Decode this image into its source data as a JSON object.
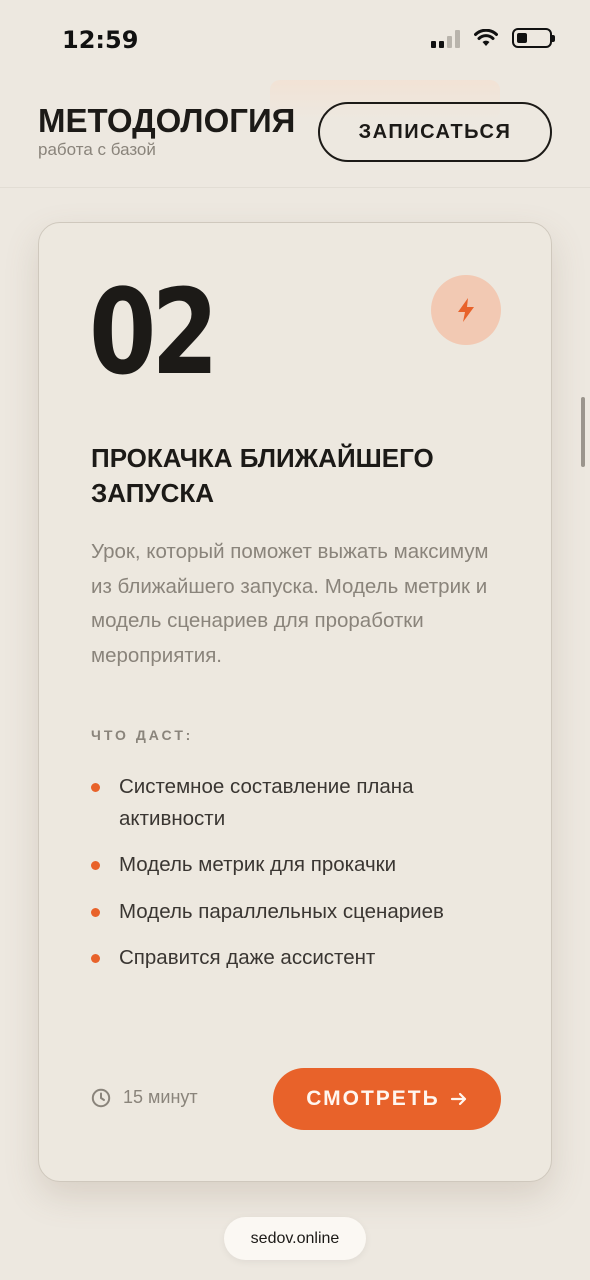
{
  "status_bar": {
    "time": "12:59"
  },
  "header": {
    "title": "МЕТОДОЛОГИЯ",
    "subtitle": "работа с базой",
    "signup_label": "ЗАПИСАТЬСЯ"
  },
  "card": {
    "number": "02",
    "title": "ПРОКАЧКА БЛИЖАЙШЕГО ЗАПУСКА",
    "description": "Урок, который поможет выжать максимум из ближайшего запуска. Модель метрик и модель сценариев для проработки мероприятия.",
    "benefits_label": "ЧТО ДАСТ:",
    "benefits": [
      "Системное составление плана активности",
      "Модель метрик для прокачки",
      "Модель параллельных сценариев",
      "Справится даже ассистент"
    ],
    "duration": "15 минут",
    "watch_label": "СМОТРЕТЬ",
    "icons": {
      "badge": "lightning-bolt-icon",
      "duration": "clock-icon",
      "watch": "arrow-right-icon"
    },
    "accent_color": "#e8622a"
  },
  "browser": {
    "url": "sedov.online"
  }
}
